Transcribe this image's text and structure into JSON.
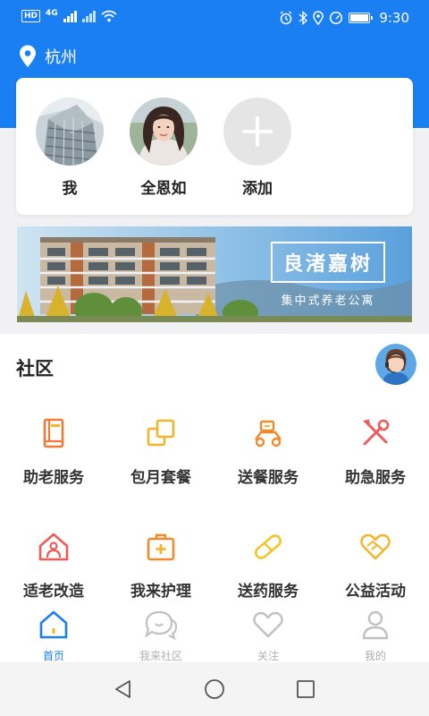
{
  "status_bar": {
    "hd_label": "HD",
    "network": "4G",
    "time": "9:30",
    "icons": [
      "alarm-icon",
      "bluetooth-icon",
      "location-icon",
      "speedometer-icon",
      "battery-icon"
    ]
  },
  "header": {
    "city": "杭州",
    "accent_color": "#1a7ff2"
  },
  "contacts": [
    {
      "name": "我",
      "avatar": "building-photo"
    },
    {
      "name": "全恩如",
      "avatar": "woman-photo"
    },
    {
      "name": "添加",
      "avatar": "add-icon"
    }
  ],
  "banner": {
    "title": "良渚嘉树",
    "subtitle": "集中式养老公寓"
  },
  "community": {
    "title": "社区",
    "services": [
      {
        "label": "助老服务",
        "icon": "book-icon",
        "color": "#f07a3a"
      },
      {
        "label": "包月套餐",
        "icon": "squares-icon",
        "color": "#f5b528"
      },
      {
        "label": "送餐服务",
        "icon": "scooter-icon",
        "color": "#f08a2a"
      },
      {
        "label": "助急服务",
        "icon": "tools-icon",
        "color": "#ee5a5a"
      },
      {
        "label": "适老改造",
        "icon": "home-person-icon",
        "color": "#ee5a5a"
      },
      {
        "label": "我来护理",
        "icon": "medical-kit-icon",
        "color": "#f08a2a"
      },
      {
        "label": "送药服务",
        "icon": "pill-icon",
        "color": "#f5c528"
      },
      {
        "label": "公益活动",
        "icon": "heart-hands-icon",
        "color": "#f5b528"
      }
    ]
  },
  "tabs": [
    {
      "label": "首页",
      "icon": "home-icon",
      "active": true
    },
    {
      "label": "我来社区",
      "icon": "chat-icon",
      "active": false
    },
    {
      "label": "关注",
      "icon": "heart-icon",
      "active": false
    },
    {
      "label": "我的",
      "icon": "person-icon",
      "active": false
    }
  ]
}
